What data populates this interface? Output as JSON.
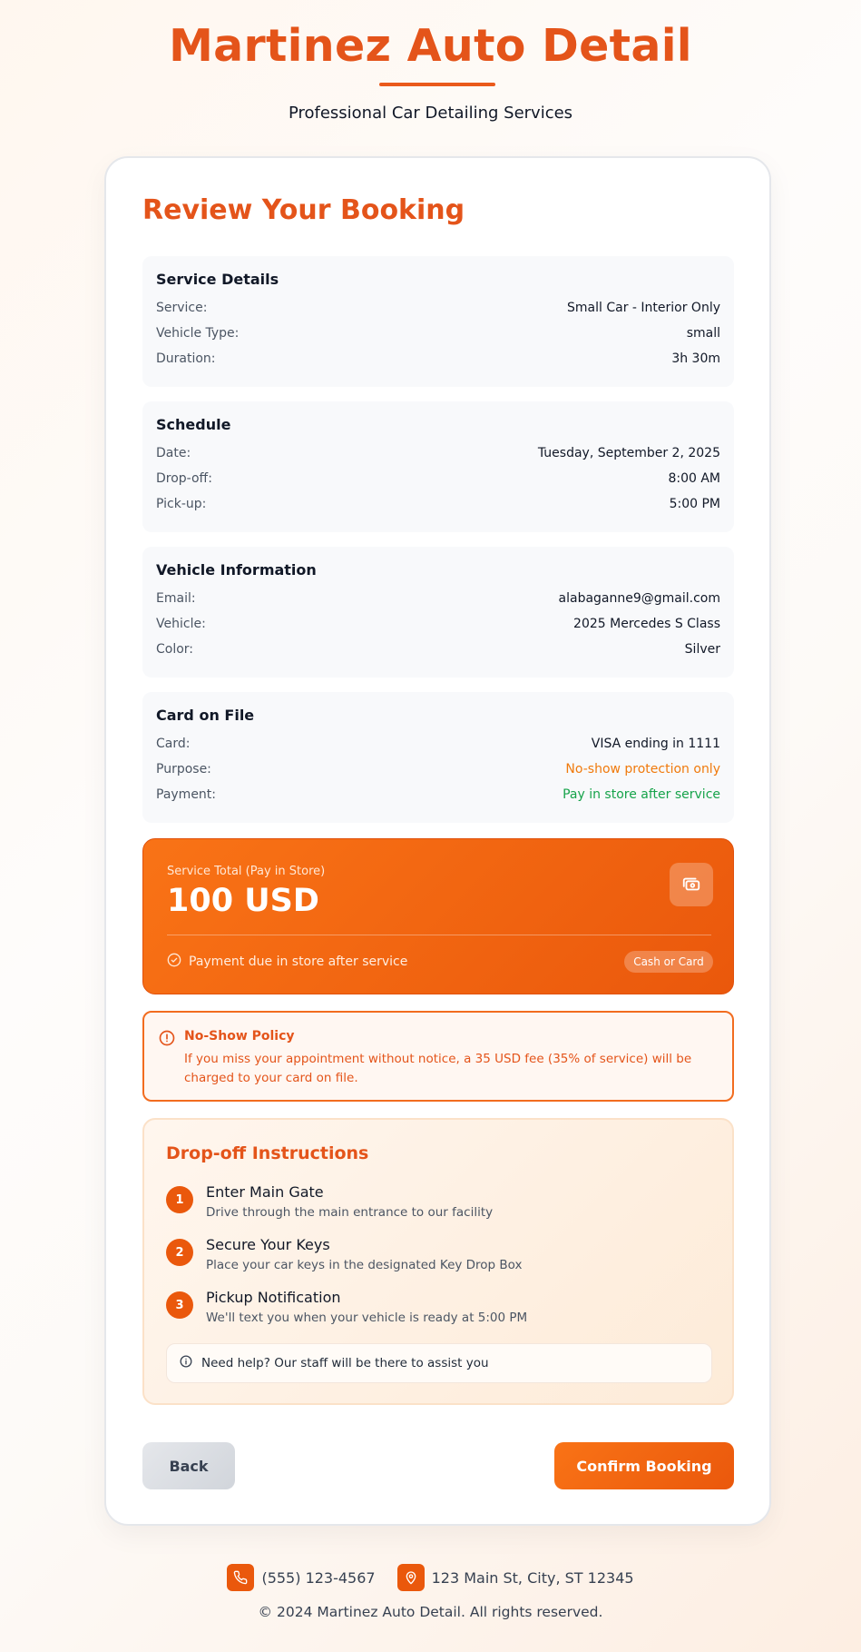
{
  "header": {
    "title": "Martinez Auto Detail",
    "subtitle": "Professional Car Detailing Services"
  },
  "review": {
    "title": "Review Your Booking",
    "service_details": {
      "heading": "Service Details",
      "rows": [
        {
          "label": "Service:",
          "value": "Small Car - Interior Only"
        },
        {
          "label": "Vehicle Type:",
          "value": "small"
        },
        {
          "label": "Duration:",
          "value": "3h 30m"
        }
      ]
    },
    "schedule": {
      "heading": "Schedule",
      "rows": [
        {
          "label": "Date:",
          "value": "Tuesday, September 2, 2025"
        },
        {
          "label": "Drop-off:",
          "value": "8:00 AM"
        },
        {
          "label": "Pick-up:",
          "value": "5:00 PM"
        }
      ]
    },
    "vehicle": {
      "heading": "Vehicle Information",
      "rows": [
        {
          "label": "Email:",
          "value": "alabaganne9@gmail.com"
        },
        {
          "label": "Vehicle:",
          "value": "2025 Mercedes S Class"
        },
        {
          "label": "Color:",
          "value": "Silver"
        }
      ]
    },
    "card_on_file": {
      "heading": "Card on File",
      "rows": [
        {
          "label": "Card:",
          "value": "VISA ending in 1111"
        },
        {
          "label": "Purpose:",
          "value": "No-show protection only"
        },
        {
          "label": "Payment:",
          "value": "Pay in store after service"
        }
      ]
    }
  },
  "total": {
    "label": "Service Total (Pay in Store)",
    "amount": "100 USD",
    "note": "Payment due in store after service",
    "pill": "Cash or Card",
    "icon": "cash-icon"
  },
  "policy": {
    "title": "No-Show Policy",
    "text": "If you miss your appointment without notice, a 35 USD fee (35% of service) will be charged to your card on file."
  },
  "dropoff": {
    "title": "Drop-off Instructions",
    "steps": [
      {
        "num": "1",
        "title": "Enter Main Gate",
        "desc": "Drive through the main entrance to our facility"
      },
      {
        "num": "2",
        "title": "Secure Your Keys",
        "desc": "Place your car keys in the designated Key Drop Box"
      },
      {
        "num": "3",
        "title": "Pickup Notification",
        "desc": "We'll text you when your vehicle is ready at 5:00 PM"
      }
    ],
    "help": "Need help? Our staff will be there to assist you"
  },
  "actions": {
    "back": "Back",
    "confirm": "Confirm Booking"
  },
  "footer": {
    "phone": "(555) 123-4567",
    "address": "123 Main St, City, ST 12345",
    "copyright": "2024 Martinez Auto Detail. All rights reserved.",
    "copyright_symbol": "©"
  },
  "colors": {
    "brand": "#e4541a",
    "accent": "#ea580c",
    "warning_text": "#f07a0c",
    "success_text": "#16a34a"
  }
}
